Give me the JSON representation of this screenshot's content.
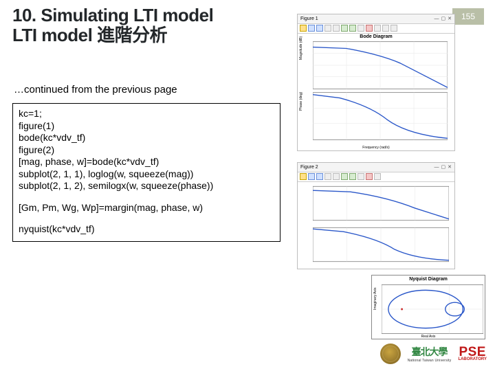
{
  "page_number": "155",
  "title_line1": "10. Simulating LTI model",
  "title_line2": "LTI model 進階分析",
  "continued": "…continued from the previous page",
  "code": {
    "l1": "kc=1;",
    "l2": "figure(1)",
    "l3": "bode(kc*vdv_tf)",
    "l4": "figure(2)",
    "l5": "[mag, phase, w]=bode(kc*vdv_tf)",
    "l6": "subplot(2, 1, 1), loglog(w, squeeze(mag))",
    "l7": "subplot(2, 1, 2), semilogx(w, squeeze(phase))",
    "l8": "[Gm, Pm, Wg, Wp]=margin(mag, phase, w)",
    "l9": "nyquist(kc*vdv_tf)"
  },
  "fig1": {
    "win_title": "Figure 1",
    "title": "Bode Diagram",
    "ylabel1": "Magnitude (dB)",
    "ylabel2": "Phase (deg)",
    "xlabel": "Frequency (rad/s)"
  },
  "fig2": {
    "win_title": "Figure 2"
  },
  "fig3": {
    "title": "Nyquist Diagram",
    "ylabel": "Imaginary Axis",
    "xlabel": "Real Axis"
  },
  "logo": {
    "zh": "臺北大學",
    "en": "National Taiwan University",
    "pse": "PSE",
    "pse_sub": "LABORATORY"
  },
  "chart_data": [
    {
      "type": "line",
      "title": "Bode Diagram — Magnitude",
      "xlabel": "Frequency (rad/s)",
      "ylabel": "Magnitude (dB)",
      "xscale": "log",
      "xlim": [
        0.01,
        100
      ],
      "ylim": [
        -80,
        0
      ],
      "series": [
        {
          "name": "kc*vdv_tf",
          "x": [
            0.01,
            0.1,
            1,
            3,
            10,
            30,
            100
          ],
          "values": [
            -8,
            -10,
            -20,
            -32,
            -50,
            -65,
            -80
          ]
        }
      ]
    },
    {
      "type": "line",
      "title": "Bode Diagram — Phase",
      "xlabel": "Frequency (rad/s)",
      "ylabel": "Phase (deg)",
      "xscale": "log",
      "xlim": [
        0.01,
        100
      ],
      "ylim": [
        -180,
        0
      ],
      "series": [
        {
          "name": "kc*vdv_tf",
          "x": [
            0.01,
            0.1,
            0.5,
            1,
            3,
            10,
            100
          ],
          "values": [
            0,
            -20,
            -70,
            -100,
            -150,
            -175,
            -180
          ]
        }
      ]
    },
    {
      "type": "line",
      "title": "loglog(w, squeeze(mag))",
      "xscale": "log",
      "yscale": "log",
      "xlim": [
        0.01,
        100
      ],
      "ylim": [
        0.0001,
        1
      ],
      "series": [
        {
          "name": "mag",
          "x": [
            0.01,
            0.1,
            1,
            10,
            100
          ],
          "values": [
            0.4,
            0.35,
            0.1,
            0.003,
            0.0001
          ]
        }
      ]
    },
    {
      "type": "line",
      "title": "semilogx(w, squeeze(phase))",
      "xscale": "log",
      "xlim": [
        0.01,
        100
      ],
      "ylim": [
        -200,
        0
      ],
      "series": [
        {
          "name": "phase",
          "x": [
            0.01,
            0.1,
            1,
            10,
            100
          ],
          "values": [
            0,
            -20,
            -100,
            -175,
            -180
          ]
        }
      ]
    },
    {
      "type": "line",
      "title": "Nyquist Diagram",
      "xlabel": "Real Axis",
      "ylabel": "Imaginary Axis",
      "xlim": [
        -1,
        0.5
      ],
      "ylim": [
        -0.3,
        0.3
      ],
      "annotations": [
        "+1 encirclement marker"
      ],
      "series": [
        {
          "name": "nyquist(kc*vdv_tf)",
          "note": "closed oval crossing neg real axis"
        }
      ]
    }
  ]
}
